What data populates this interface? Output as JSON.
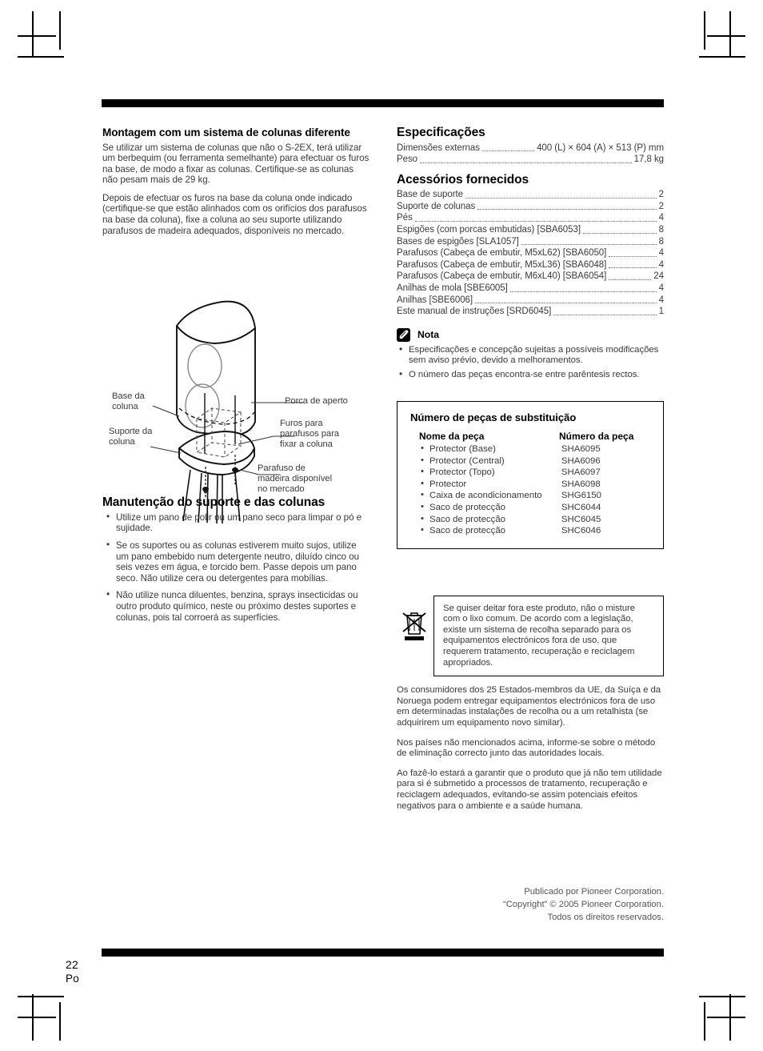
{
  "page": {
    "number": "22",
    "language_code": "Po"
  },
  "left_column": {
    "section1": {
      "heading": "Montagem com um sistema de colunas diferente",
      "paragraphs": [
        "Se utilizar um sistema de colunas que não o S-2EX, terá utilizar um berbequim (ou ferramenta semelhante) para efectuar os furos na base, de modo a fixar as colunas. Certifique-se as colunas não pesam mais de 29 kg.",
        "Depois de efectuar os furos na base da coluna onde indicado (certifique-se que estão alinhados com os orifícios dos parafusos na base da coluna), fixe a coluna ao seu suporte utilizando parafusos de madeira adequados, disponíveis no mercado."
      ]
    },
    "figure": {
      "labels": {
        "base_da_coluna": "Base da\ncoluna",
        "suporte_da_coluna": "Suporte da\ncoluna",
        "porca_de_aperto": "Porca de aperto",
        "furos_para_parafusos": "Furos para\nparafusos para\nfixar a coluna",
        "parafuso_de_madeira": "Parafuso de\nmadeira disponível\nno mercado"
      }
    },
    "section2": {
      "heading": "Manutenção do suporte e das colunas",
      "bullets": [
        "Utilize um pano de polir ou um pano seco para limpar o pó e sujidade.",
        "Se os suportes ou as colunas estiverem muito sujos, utilize um pano embebido num detergente neutro, diluído cinco ou seis vezes em água, e torcido bem. Passe depois um pano seco. Não utilize cera ou detergentes para mobílias.",
        "Não utilize nunca diluentes, benzina, sprays insecticidas ou outro produto químico, neste ou próximo destes suportes e colunas, pois tal corroerá as superfícies."
      ]
    }
  },
  "right_column": {
    "specifications": {
      "heading": "Especificações",
      "rows": [
        {
          "name": "Dimensões externas",
          "value": "400 (L) × 604 (A) × 513 (P) mm"
        },
        {
          "name": "Peso",
          "value": "17,8 kg"
        }
      ]
    },
    "accessories": {
      "heading": "Acessórios fornecidos",
      "rows": [
        {
          "name": "Base de suporte",
          "value": "2"
        },
        {
          "name": "Suporte de colunas",
          "value": "2"
        },
        {
          "name": "Pés",
          "value": "4"
        },
        {
          "name": "Espigões (com porcas embutidas) [SBA6053]",
          "value": "8"
        },
        {
          "name": "Bases de espigões [SLA1057]",
          "value": "8"
        },
        {
          "name": "Parafusos (Cabeça de embutir, M5xL62) [SBA6050]",
          "value": "4"
        },
        {
          "name": "Parafusos (Cabeça de embutir, M5xL36) [SBA6048]",
          "value": "4"
        },
        {
          "name": "Parafusos (Cabeça de embutir, M6xL40) [SBA6054]",
          "value": "24"
        },
        {
          "name": "Anilhas de mola [SBE6005]",
          "value": "4"
        },
        {
          "name": "Anilhas [SBE6006]",
          "value": "4"
        },
        {
          "name": "Este manual de instruções [SRD6045]",
          "value": "1"
        }
      ]
    },
    "note": {
      "icon": "pencil-icon",
      "title": "Nota",
      "bullets": [
        "Especificações e concepção sujeitas a possíveis modificações sem aviso prévio, devido a melhoramentos.",
        "O número das peças encontra-se entre parêntesis rectos."
      ]
    },
    "parts_table": {
      "title": "Número de peças de substituição",
      "headers": {
        "name": "Nome da peça",
        "number": "Número da peça"
      },
      "rows": [
        {
          "name": "Protector (Base)",
          "number": "SHA6095"
        },
        {
          "name": "Protector (Central)",
          "number": "SHA6096"
        },
        {
          "name": "Protector (Topo)",
          "number": "SHA6097"
        },
        {
          "name": "Protector",
          "number": "SHA6098"
        },
        {
          "name": "Caixa de acondicionamento",
          "number": "SHG6150"
        },
        {
          "name": "Saco de protecção",
          "number": "SHC6044"
        },
        {
          "name": "Saco de protecção",
          "number": "SHC6045"
        },
        {
          "name": "Saco de protecção",
          "number": "SHC6046"
        }
      ]
    },
    "weee": {
      "icon": "crossed-out-wheelie-bin-icon",
      "boxed_text": "Se quiser deitar fora este produto, não o misture com o lixo comum. De acordo com a legislação, existe um sistema de recolha separado para os equipamentos electrónicos fora de uso, que requerem tratamento, recuperação e reciclagem apropriados.",
      "paragraphs": [
        "Os consumidores dos 25 Estados-membros da UE, da Suíça e da Noruega podem entregar equipamentos electrónicos fora de uso em determinadas instalações de recolha ou a um retalhista (se adquirirem um equipamento novo similar).",
        "Nos países não mencionados acima, informe-se sobre o método de eliminação correcto junto das autoridades locais.",
        "Ao fazê-lo estará a garantir que o produto que já não tem utilidade para si é submetido a processos de tratamento, recuperação e reciclagem adequados, evitando-se assim potenciais efeitos negativos para o ambiente e a saúde humana."
      ]
    },
    "copyright": {
      "line1": "Publicado por Pioneer Corporation.",
      "line2": "“Copyright” © 2005 Pioneer Corporation.",
      "line3": "Todos os direitos reservados."
    }
  }
}
